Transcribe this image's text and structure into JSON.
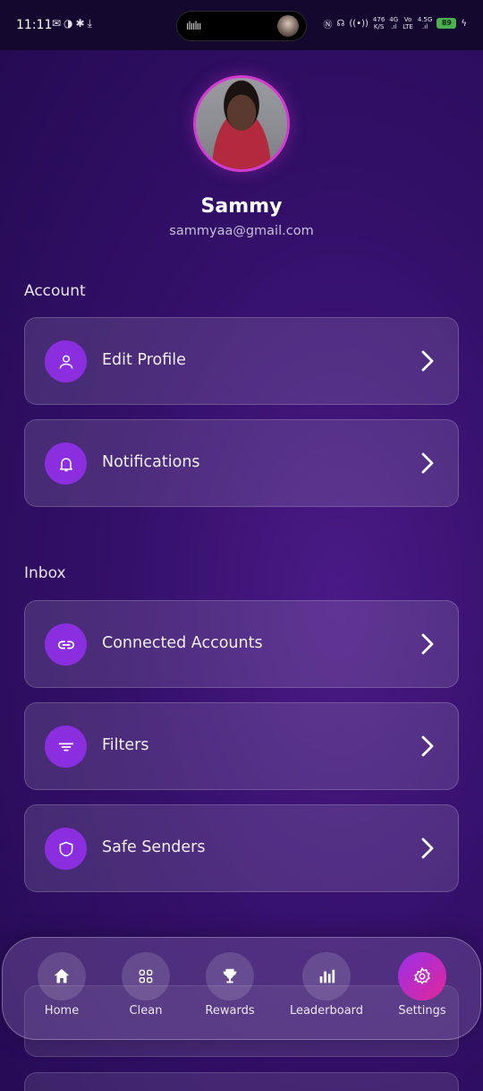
{
  "status_bar": {
    "time": "11:11",
    "net_speed_value": "476",
    "net_speed_unit": "K/S",
    "network_1": "4G",
    "network_2_top": "Vo",
    "network_2_bottom": "LTE",
    "network_3": "4.5G",
    "battery": "89"
  },
  "profile": {
    "name": "Sammy",
    "email": "sammyaa@gmail.com"
  },
  "sections": {
    "account_title": "Account",
    "inbox_title": "Inbox"
  },
  "account_items": [
    {
      "label": "Edit Profile",
      "icon": "user-icon"
    },
    {
      "label": "Notifications",
      "icon": "bell-icon"
    }
  ],
  "inbox_items": [
    {
      "label": "Connected Accounts",
      "icon": "link-icon"
    },
    {
      "label": "Filters",
      "icon": "filter-icon"
    },
    {
      "label": "Safe Senders",
      "icon": "shield-icon"
    }
  ],
  "nav": [
    {
      "label": "Home",
      "icon": "home-icon",
      "active": false
    },
    {
      "label": "Clean",
      "icon": "grid-icon",
      "active": false
    },
    {
      "label": "Rewards",
      "icon": "trophy-icon",
      "active": false
    },
    {
      "label": "Leaderboard",
      "icon": "bar-chart-icon",
      "active": false
    },
    {
      "label": "Settings",
      "icon": "gear-icon",
      "active": true
    }
  ],
  "colors": {
    "accent": "#8a2ee0",
    "active_gradient_start": "#9b2fe8",
    "active_gradient_end": "#e0289a",
    "avatar_ring": "#d23bd0"
  }
}
